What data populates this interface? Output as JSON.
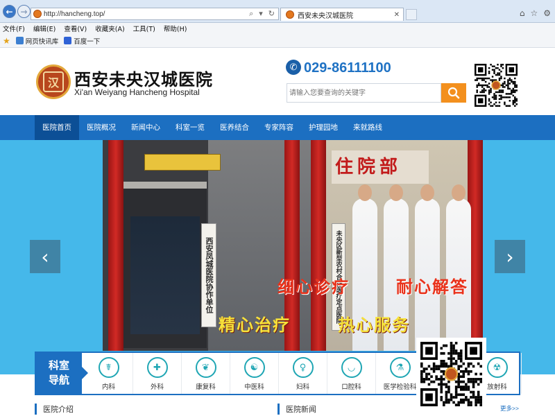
{
  "browser": {
    "url": "http://hancheng.top/",
    "tab_title": "西安未央汉城医院",
    "menu": [
      "文件(F)",
      "编辑(E)",
      "查看(V)",
      "收藏夹(A)",
      "工具(T)",
      "帮助(H)"
    ],
    "favorites": [
      "网页快讯库",
      "百度一下"
    ]
  },
  "header": {
    "name_cn": "西安未央汉城医院",
    "name_en": "Xi'an Weiyang Hancheng Hospital",
    "phone": "029-86111100",
    "search_placeholder": "请输入您要查询的关键字"
  },
  "nav": {
    "items": [
      "医院首页",
      "医院概况",
      "新闻中心",
      "科室一览",
      "医养结合",
      "专家阵容",
      "护理园地",
      "来就路线"
    ]
  },
  "banner": {
    "ward_sign": "住院部",
    "sign_left": "西安凤城医院协作单位",
    "sign_mid": "未央区新型农村合作医疗定点医院",
    "slogans": [
      "细心诊疗",
      "耐心解答",
      "精心治疗",
      "热心服务"
    ]
  },
  "departments": {
    "label_line1": "科室",
    "label_line2": "导航",
    "items": [
      {
        "name": "内科",
        "icon": "stethoscope-icon",
        "glyph": "☤"
      },
      {
        "name": "外科",
        "icon": "surgery-icon",
        "glyph": "✚"
      },
      {
        "name": "康复科",
        "icon": "leaf-icon",
        "glyph": "❦"
      },
      {
        "name": "中医科",
        "icon": "herb-icon",
        "glyph": "☯"
      },
      {
        "name": "妇科",
        "icon": "female-icon",
        "glyph": "♀"
      },
      {
        "name": "口腔科",
        "icon": "tooth-icon",
        "glyph": "◡"
      },
      {
        "name": "医学检验科",
        "icon": "microscope-icon",
        "glyph": "⚗"
      },
      {
        "name": "",
        "icon": "hidden-icon",
        "glyph": ""
      },
      {
        "name": "放射科",
        "icon": "radiation-icon",
        "glyph": "☢"
      }
    ]
  },
  "sections": {
    "intro_title": "医院介绍",
    "news_title": "医院新闻",
    "more": "更多>>"
  },
  "colors": {
    "primary": "#1c6fc1",
    "accent": "#f3901e",
    "phone": "#1f72c4"
  }
}
